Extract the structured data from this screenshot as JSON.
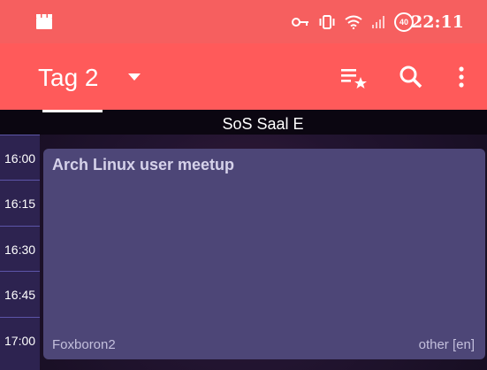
{
  "status_bar": {
    "clock": "22:11",
    "battery_level": "40",
    "icons": [
      "app-icon",
      "vpn-key-icon",
      "vibrate-icon",
      "wifi-icon",
      "cell-signal-icon",
      "battery-saver-icon"
    ]
  },
  "app_bar": {
    "title": "Tag 2",
    "actions": [
      "favorites-icon",
      "search-icon",
      "more-vert-icon"
    ]
  },
  "tabs": {
    "room": "SoS Saal E"
  },
  "schedule": {
    "times": [
      "16:00",
      "16:15",
      "16:30",
      "16:45",
      "17:00"
    ],
    "events": [
      {
        "title": "Arch Linux user meetup",
        "speaker": "Foxboron2",
        "track": "other [en]"
      }
    ]
  },
  "colors": {
    "status_bar": "#f65f5f",
    "app_bar": "#ff5a5a",
    "time_column": "#2d2350",
    "event_card": "#4d4677"
  }
}
